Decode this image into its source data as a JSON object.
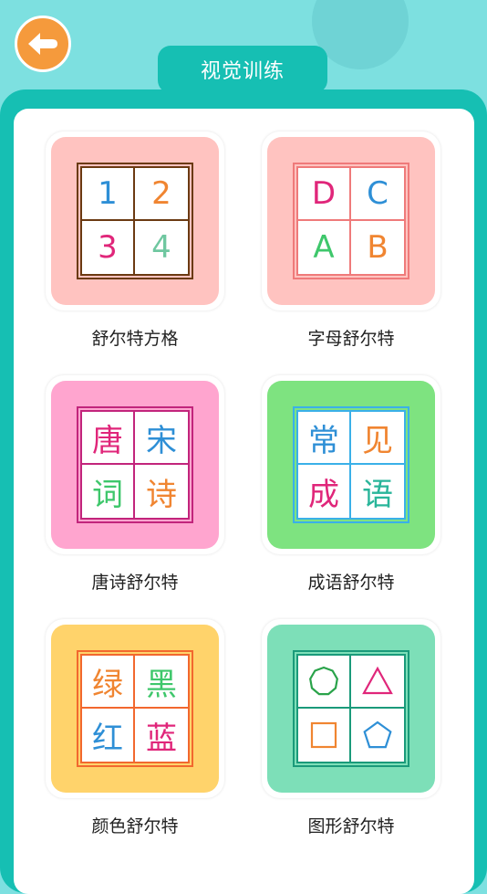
{
  "header": {
    "title": "视觉训练",
    "back_icon": "arrow-left-icon"
  },
  "colors": {
    "background": "#7de0e0",
    "frame": "#16bfb3",
    "back_button": "#f59a3c"
  },
  "cards": [
    {
      "name": "舒尔特方格",
      "tile_color": "#ffc3c0",
      "grid_color": "#6b3a12",
      "cells": [
        {
          "text": "1",
          "color": "#2e8fd6"
        },
        {
          "text": "2",
          "color": "#f08531"
        },
        {
          "text": "3",
          "color": "#e0267a"
        },
        {
          "text": "4",
          "color": "#6fc7a0"
        }
      ]
    },
    {
      "name": "字母舒尔特",
      "tile_color": "#ffc3c0",
      "grid_color": "#ef7a7a",
      "cells": [
        {
          "text": "D",
          "color": "#e0267a"
        },
        {
          "text": "C",
          "color": "#2e8fd6"
        },
        {
          "text": "A",
          "color": "#3ec76b"
        },
        {
          "text": "B",
          "color": "#f08531"
        }
      ]
    },
    {
      "name": "唐诗舒尔特",
      "tile_color": "#ffa5cf",
      "grid_color": "#c2257c",
      "cells": [
        {
          "text": "唐",
          "color": "#e0267a"
        },
        {
          "text": "宋",
          "color": "#2e8fd6"
        },
        {
          "text": "词",
          "color": "#3ec76b"
        },
        {
          "text": "诗",
          "color": "#f08531"
        }
      ]
    },
    {
      "name": "成语舒尔特",
      "tile_color": "#7ee380",
      "grid_color": "#3ab0e8",
      "cells": [
        {
          "text": "常",
          "color": "#2e8fd6"
        },
        {
          "text": "见",
          "color": "#f08531"
        },
        {
          "text": "成",
          "color": "#e0267a"
        },
        {
          "text": "语",
          "color": "#29b59a"
        }
      ]
    },
    {
      "name": "颜色舒尔特",
      "tile_color": "#ffd36b",
      "grid_color": "#f2682e",
      "cells": [
        {
          "text": "绿",
          "color": "#f08531"
        },
        {
          "text": "黑",
          "color": "#3ec76b"
        },
        {
          "text": "红",
          "color": "#2e8fd6"
        },
        {
          "text": "蓝",
          "color": "#e0267a"
        }
      ]
    },
    {
      "name": "图形舒尔特",
      "tile_color": "#7ddfb8",
      "grid_color": "#1a9a7a",
      "cells": [
        {
          "shape": "nonagon-icon",
          "color": "#2aa34a"
        },
        {
          "shape": "triangle-icon",
          "color": "#e0267a"
        },
        {
          "shape": "square-icon",
          "color": "#f08531"
        },
        {
          "shape": "pentagon-icon",
          "color": "#2e8fd6"
        }
      ]
    }
  ]
}
